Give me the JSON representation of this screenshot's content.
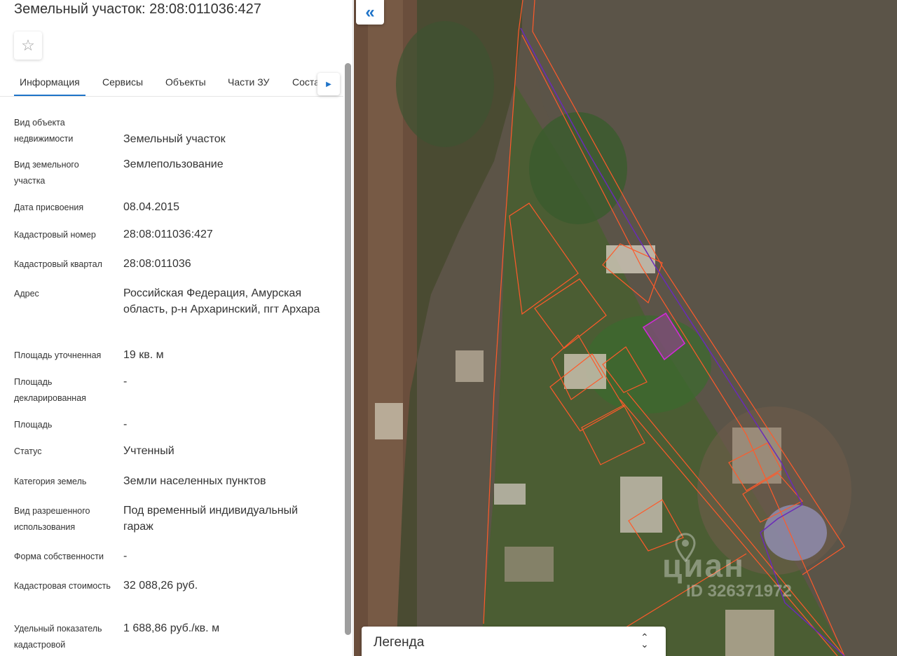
{
  "header": {
    "title": "Земельный участок: 28:08:011036:427"
  },
  "tabs": [
    {
      "label": "Информация"
    },
    {
      "label": "Сервисы"
    },
    {
      "label": "Объекты"
    },
    {
      "label": "Части ЗУ"
    },
    {
      "label": "Соста"
    }
  ],
  "info": [
    {
      "label": "Вид объекта недвижимости",
      "value": "Земельный участок"
    },
    {
      "label": "Вид земельного участка",
      "value": "Землепользование"
    },
    {
      "label": "Дата присвоения",
      "value": "08.04.2015"
    },
    {
      "label": "Кадастровый номер",
      "value": "28:08:011036:427"
    },
    {
      "label": "Кадастровый квартал",
      "value": "28:08:011036"
    },
    {
      "label": "Адрес",
      "value": "Российская Федерация, Амурская область, р-н Архаринский, пгт Архара"
    },
    {
      "label": "Площадь уточненная",
      "value": "19 кв. м"
    },
    {
      "label": "Площадь декларированная",
      "value": "-"
    },
    {
      "label": "Площадь",
      "value": "-"
    },
    {
      "label": "Статус",
      "value": "Учтенный"
    },
    {
      "label": "Категория земель",
      "value": "Земли населенных пунктов"
    },
    {
      "label": "Вид разрешенного использования",
      "value": "Под временный индивидуальный гараж"
    },
    {
      "label": "Форма собственности",
      "value": "-"
    },
    {
      "label": "Кадастровая стоимость",
      "value": "32 088,26 руб."
    },
    {
      "label": "Удельный показатель кадастровой",
      "value": "1 688,86 руб./кв. м"
    }
  ],
  "map": {
    "legend_label": "Легенда",
    "watermark_brand": "циан",
    "watermark_id": "ID 326371972",
    "colors": {
      "parcel_outline": "#ff5a2a",
      "selected_parcel": "#d22ad8",
      "boundary_line": "#6a2ab8"
    }
  },
  "icons": {
    "star": "star-icon",
    "next": "chevron-right-icon",
    "collapse": "double-chevron-left-icon",
    "legend_toggle": "chevron-up-down-icon"
  }
}
